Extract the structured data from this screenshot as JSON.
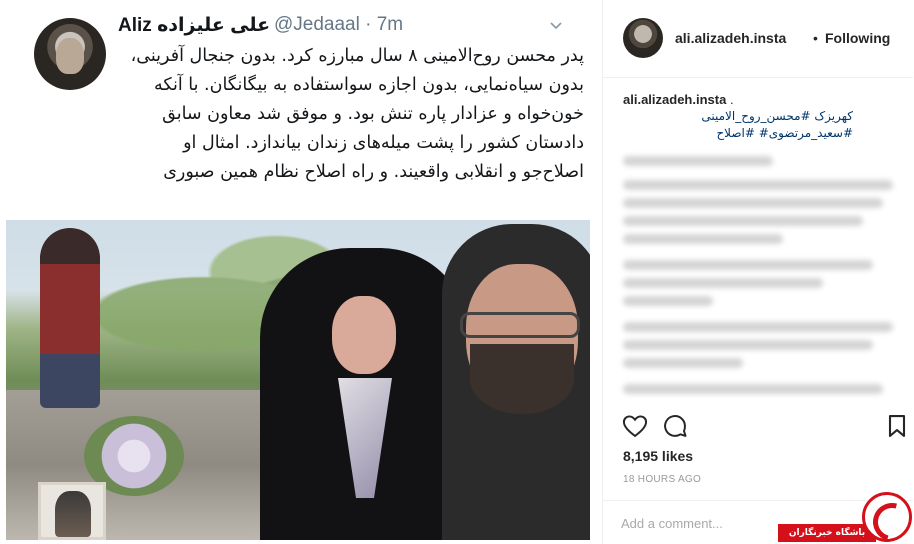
{
  "tweet": {
    "display_name": "Aliz علی علیزاده",
    "handle": "@Jedaaal · 7m",
    "chevron_icon": "chevron-down-icon",
    "body": "پدر محسن روح‌الامینی ۸ سال مبارزه کرد. بدون جنجال آفرینی، بدون سیاه‌نمایی، بدون اجازه سواستفاده به بیگانگان. با آنکه خون‌خواه و عزادار پاره تنش بود. و موفق شد معاون سابق دادستان کشور را پشت میله‌های زندان بیاندازد. امثال او اصلاح‌جو و انقلابی واقعیند. و راه اصلاح نظام همین صبوری"
  },
  "instagram": {
    "username": "ali.alizadeh.insta",
    "separator": "•",
    "follow_status": "Following",
    "caption_user": "ali.alizadeh.insta",
    "caption_text": ".",
    "hashtags": "کهریزک #محسن_روح_الامینی #سعید_مرتضوی# #اصلاح",
    "icons": {
      "like": "heart-icon",
      "comment": "comment-icon",
      "save": "bookmark-icon"
    },
    "likes": "8,195 likes",
    "time": "18 HOURS AGO",
    "comment_placeholder": "Add a comment..."
  },
  "watermark": {
    "label": "باشگاه خبرنگاران",
    "brand_color": "#d4111a"
  }
}
